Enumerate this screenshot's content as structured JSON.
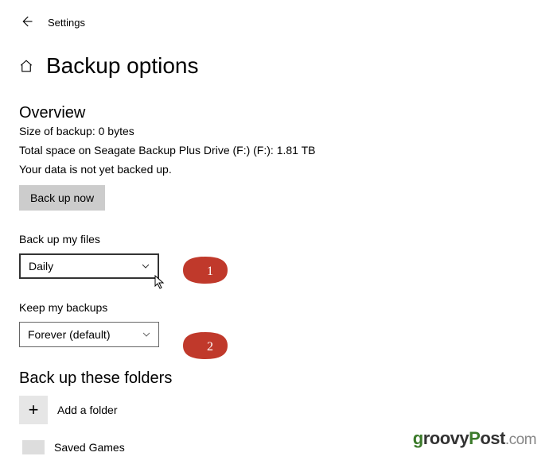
{
  "header": {
    "settings_label": "Settings"
  },
  "page": {
    "title": "Backup options"
  },
  "overview": {
    "heading": "Overview",
    "size_line": "Size of backup: 0 bytes",
    "space_line": "Total space on Seagate Backup Plus Drive (F:) (F:): 1.81 TB",
    "status_line": "Your data is not yet backed up.",
    "backup_now_label": "Back up now"
  },
  "backup_frequency": {
    "label": "Back up my files",
    "value": "Daily"
  },
  "keep_backups": {
    "label": "Keep my backups",
    "value": "Forever (default)"
  },
  "folders": {
    "heading": "Back up these folders",
    "add_label": "Add a folder",
    "item1": "Saved Games"
  },
  "callouts": {
    "one": "1",
    "two": "2"
  },
  "footer": {
    "brand": "groovyPost",
    "suffix": ".com"
  }
}
